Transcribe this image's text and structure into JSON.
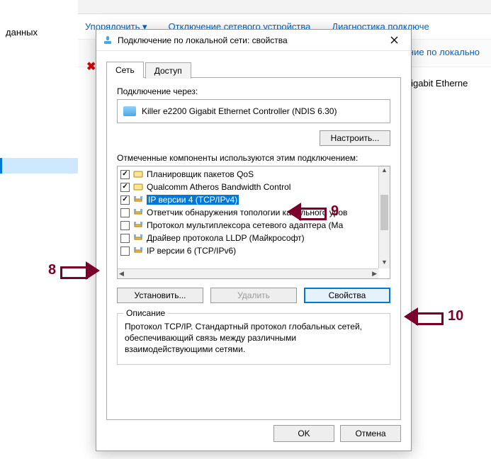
{
  "bg": {
    "left_text": "данных",
    "toolbar_items": [
      "Упорядочить ▾",
      "Отключение сетевого устройства",
      "Диагностика подключе"
    ],
    "bar2_text": "ение по локально",
    "list_text": "Gigabit Etherne"
  },
  "dialog": {
    "title": "Подключение по локальной сети: свойства",
    "tabs": {
      "network": "Сеть",
      "access": "Доступ"
    },
    "connect_via_label": "Подключение через:",
    "adapter_name": "Killer e2200 Gigabit Ethernet Controller (NDIS 6.30)",
    "configure_btn": "Настроить...",
    "components_label": "Отмеченные компоненты используются этим подключением:",
    "components": [
      {
        "checked": true,
        "icon": "service",
        "label": "Планировщик пакетов QoS"
      },
      {
        "checked": true,
        "icon": "service",
        "label": "Qualcomm Atheros Bandwidth Control"
      },
      {
        "checked": true,
        "icon": "protocol",
        "label": "IP версии 4 (TCP/IPv4)",
        "selected": true
      },
      {
        "checked": false,
        "icon": "protocol",
        "label": "Ответчик обнаружения топологии канального уров"
      },
      {
        "checked": false,
        "icon": "protocol",
        "label": "Протокол мультиплексора сетевого адаптера (Ма"
      },
      {
        "checked": false,
        "icon": "protocol",
        "label": "Драйвер протокола LLDP (Майкрософт)"
      },
      {
        "checked": false,
        "icon": "protocol",
        "label": "IP версии 6 (TCP/IPv6)"
      }
    ],
    "install_btn": "Установить...",
    "remove_btn": "Удалить",
    "properties_btn": "Свойства",
    "desc_group": "Описание",
    "desc_text": "Протокол TCP/IP. Стандартный протокол глобальных сетей, обеспечивающий связь между различными взаимодействующими сетями.",
    "ok_btn": "OK",
    "cancel_btn": "Отмена"
  },
  "annotations": {
    "a8": "8",
    "a9": "9",
    "a10": "10"
  }
}
